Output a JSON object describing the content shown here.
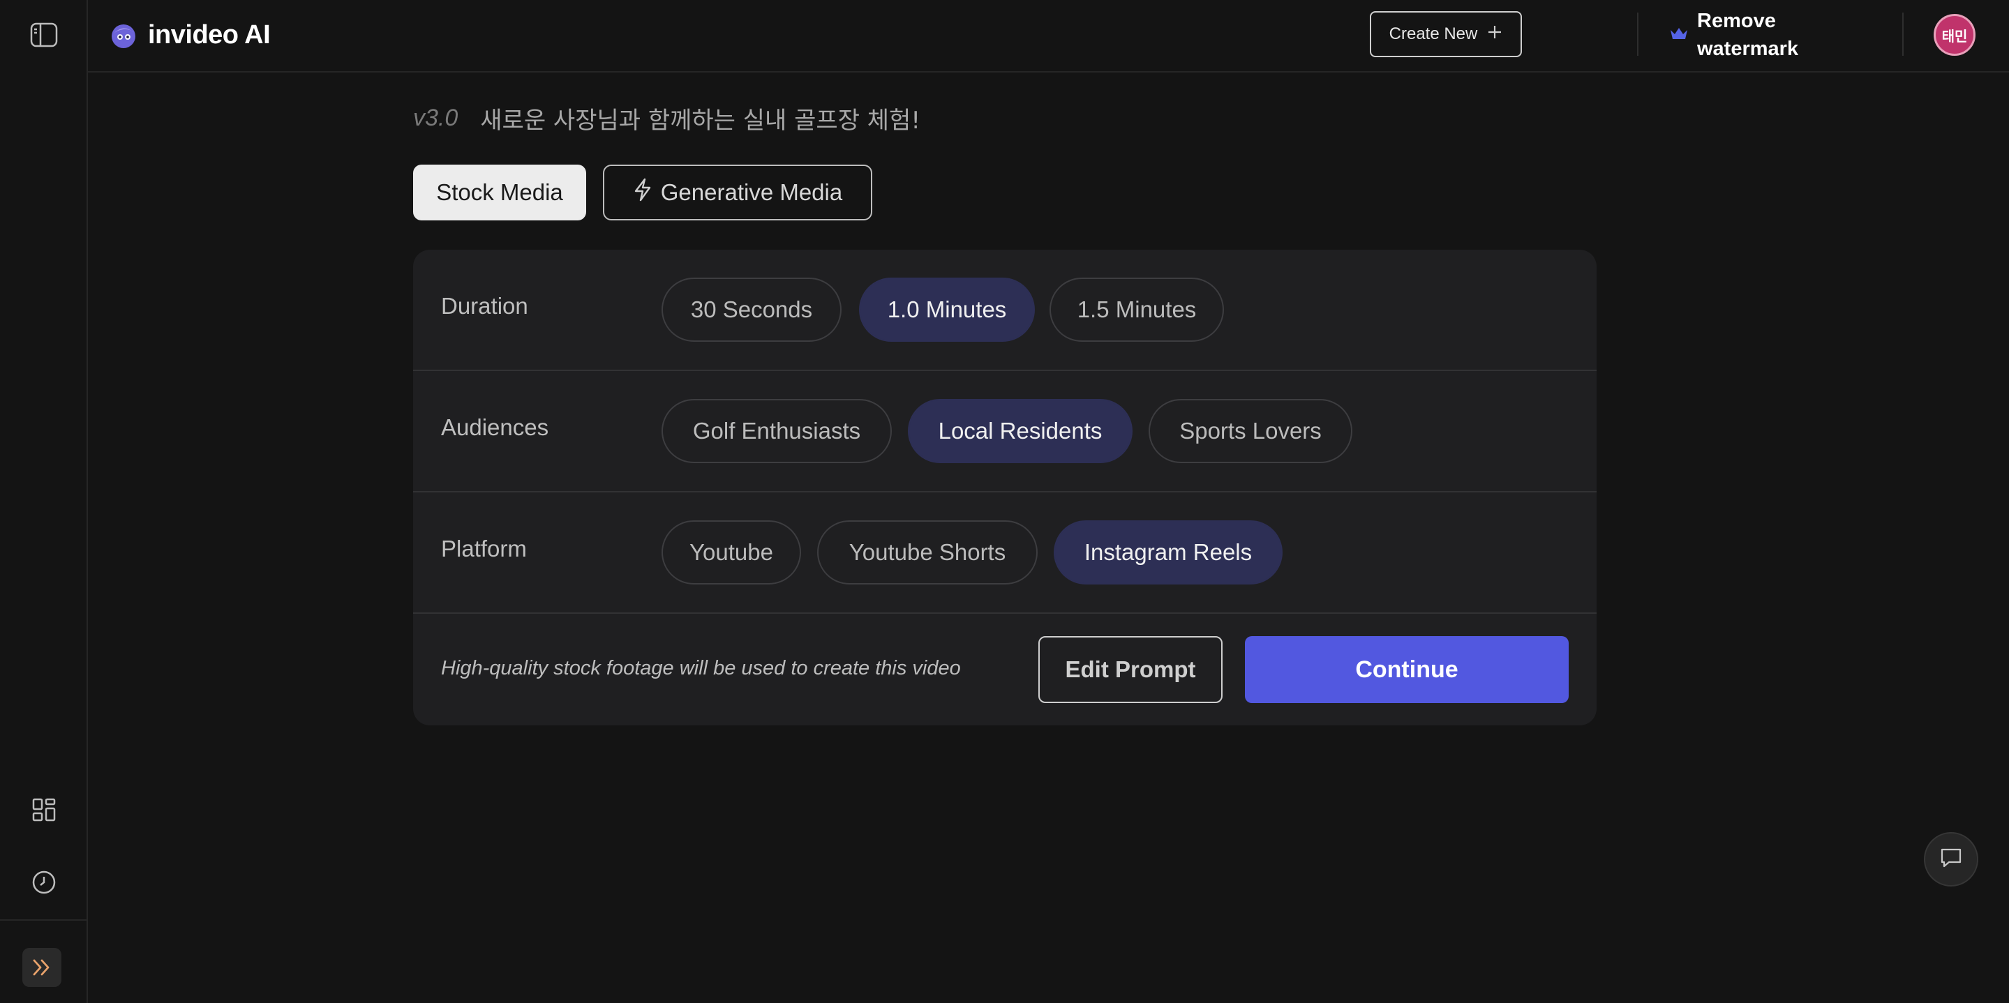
{
  "app": {
    "brand": "invideo AI"
  },
  "header": {
    "create_new_label": "Create New",
    "remove_watermark_label": "Remove watermark",
    "avatar_initials": "태민",
    "accent_color": "#5258e0"
  },
  "main": {
    "version": "v3.0",
    "title": "새로운 사장님과 함께하는 실내 골프장 체험!",
    "media_tabs": [
      {
        "label": "Stock Media",
        "selected": true
      },
      {
        "label": "Generative Media",
        "selected": false,
        "icon": "lightning-icon"
      }
    ],
    "options": {
      "duration": {
        "label": "Duration",
        "choices": [
          "30 Seconds",
          "1.0 Minutes",
          "1.5 Minutes"
        ],
        "selected": "1.0 Minutes"
      },
      "audiences": {
        "label": "Audiences",
        "choices": [
          "Golf Enthusiasts",
          "Local Residents",
          "Sports Lovers"
        ],
        "selected": "Local Residents"
      },
      "platform": {
        "label": "Platform",
        "choices": [
          "Youtube",
          "Youtube Shorts",
          "Instagram Reels"
        ],
        "selected": "Instagram Reels"
      }
    },
    "footer_note": "High-quality stock footage will be used to create this video",
    "edit_prompt_label": "Edit Prompt",
    "continue_label": "Continue"
  },
  "sidebar": {
    "icons": [
      "sidebar-toggle-icon",
      "grid-icon",
      "history-clock-icon",
      "expand-chevrons-icon"
    ]
  }
}
